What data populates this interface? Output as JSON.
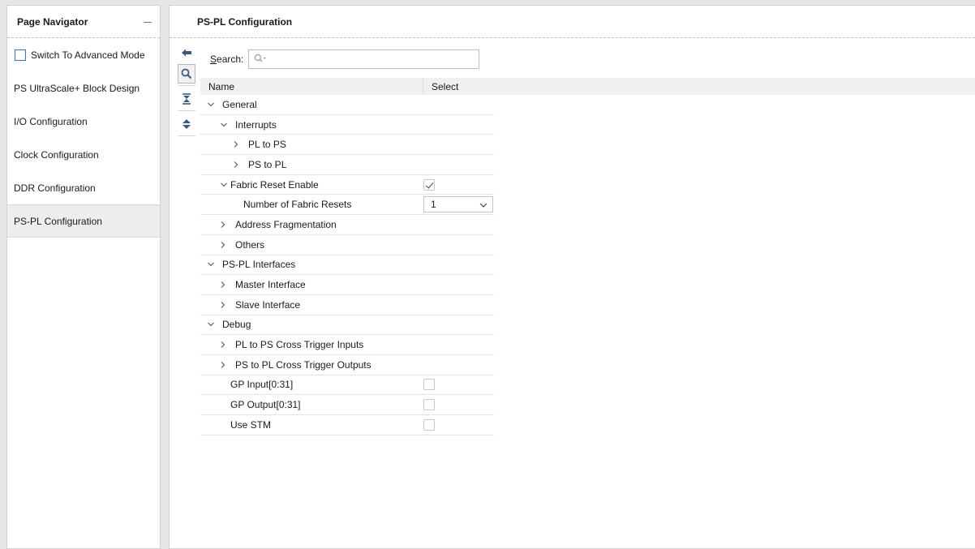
{
  "navigator": {
    "title": "Page Navigator",
    "advanced_mode_label": "Switch To Advanced Mode",
    "items": [
      {
        "label": "PS UltraScale+ Block Design"
      },
      {
        "label": "I/O Configuration"
      },
      {
        "label": "Clock Configuration"
      },
      {
        "label": "DDR Configuration"
      },
      {
        "label": "PS-PL Configuration",
        "selected": true
      }
    ]
  },
  "main": {
    "title": "PS-PL Configuration",
    "search": {
      "label_prefix": "S",
      "label_rest": "earch:",
      "value": "",
      "icon": "search-icon"
    },
    "toolbar": [
      "back-arrow-icon",
      "search-icon",
      "collapse-all-icon",
      "expand-all-icon"
    ],
    "columns": {
      "name": "Name",
      "select": "Select"
    },
    "rows": [
      {
        "label": "General",
        "level": 0,
        "expander": "open"
      },
      {
        "label": "Interrupts",
        "level": 1,
        "expander": "open"
      },
      {
        "label": "PL to PS",
        "level": 2,
        "expander": "closed"
      },
      {
        "label": "PS to PL",
        "level": 2,
        "expander": "closed"
      },
      {
        "label": "Fabric Reset Enable",
        "level": 1,
        "expander": "open-tight",
        "control": "checkbox",
        "checked": true
      },
      {
        "label": "Number of Fabric Resets",
        "level": 3,
        "expander": "none",
        "control": "select",
        "value": "1"
      },
      {
        "label": "Address Fragmentation",
        "level": 1,
        "expander": "closed"
      },
      {
        "label": "Others",
        "level": 1,
        "expander": "closed"
      },
      {
        "label": "PS-PL Interfaces",
        "level": 0,
        "expander": "open"
      },
      {
        "label": "Master Interface",
        "level": 1,
        "expander": "closed"
      },
      {
        "label": "Slave Interface",
        "level": 1,
        "expander": "closed"
      },
      {
        "label": "Debug",
        "level": 0,
        "expander": "open"
      },
      {
        "label": "PL to PS Cross Trigger Inputs",
        "level": 1,
        "expander": "closed"
      },
      {
        "label": "PS to PL Cross Trigger Outputs",
        "level": 1,
        "expander": "closed"
      },
      {
        "label": "GP Input[0:31]",
        "level": 1,
        "expander": "none",
        "control": "checkbox",
        "checked": false
      },
      {
        "label": "GP Output[0:31]",
        "level": 1,
        "expander": "none",
        "control": "checkbox",
        "checked": false
      },
      {
        "label": "Use STM",
        "level": 1,
        "expander": "none",
        "control": "checkbox",
        "checked": false
      }
    ]
  },
  "colors": {
    "accent": "#3b73b9",
    "icon": "#3c5a80"
  }
}
